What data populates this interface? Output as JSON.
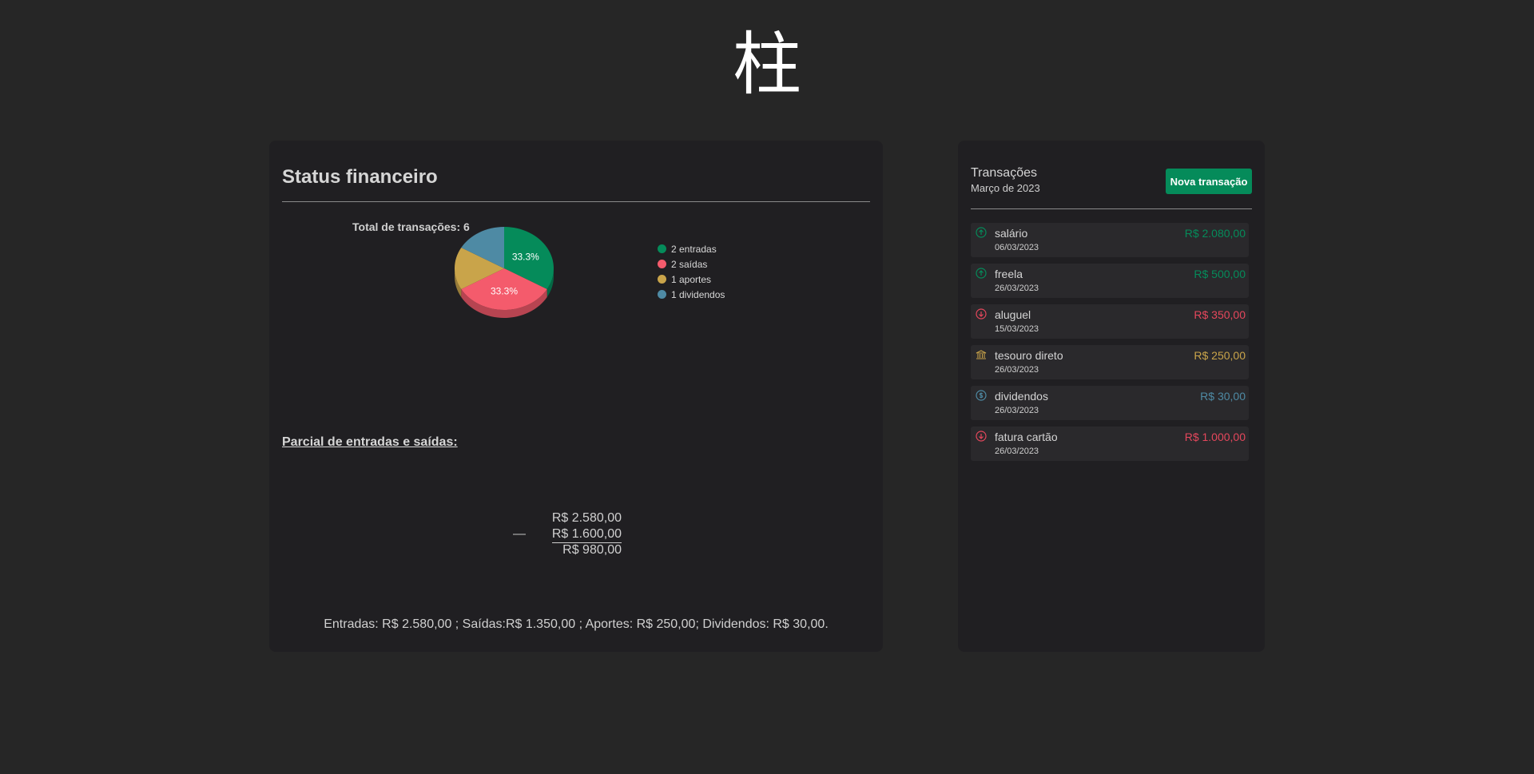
{
  "logo_text": "柱",
  "status": {
    "title": "Status financeiro",
    "partial_title": "Parcial de entradas e saídas:",
    "calc": {
      "income": "R$ 2.580,00",
      "minus_sign": "—",
      "expense": "R$ 1.600,00",
      "result": "R$ 980,00"
    },
    "summary": "Entradas: R$ 2.580,00 ;  Saídas:R$ 1.350,00 ;  Aportes: R$ 250,00;  Dividendos: R$ 30,00."
  },
  "chart_data": {
    "type": "pie",
    "title": "Total de transações: 6",
    "categories": [
      "2 entradas",
      "2 saídas",
      "1 aportes",
      "1 dividendos"
    ],
    "values": [
      2,
      2,
      1,
      1
    ],
    "data_labels": [
      "33.3%",
      "33.3%",
      "",
      ""
    ],
    "colors": [
      "#058b5a",
      "#f45b6c",
      "#c9a44a",
      "#4e8aa4"
    ],
    "legend_position": "right"
  },
  "transactions": {
    "title": "Transações",
    "month": "Março de 2023",
    "new_button": "Nova transação",
    "items": [
      {
        "name": "salário",
        "date": "06/03/2023",
        "amount": "R$ 2.080,00",
        "icon": "arrow-up-circle-icon",
        "color": "#058b5a"
      },
      {
        "name": "freela",
        "date": "26/03/2023",
        "amount": "R$ 500,00",
        "icon": "arrow-up-circle-icon",
        "color": "#058b5a"
      },
      {
        "name": "aluguel",
        "date": "15/03/2023",
        "amount": "R$ 350,00",
        "icon": "arrow-down-circle-icon",
        "color": "#e5475c"
      },
      {
        "name": "tesouro direto",
        "date": "26/03/2023",
        "amount": "R$ 250,00",
        "icon": "bank-icon",
        "color": "#c9a44a"
      },
      {
        "name": "dividendos",
        "date": "26/03/2023",
        "amount": "R$ 30,00",
        "icon": "dollar-circle-icon",
        "color": "#4e8aa4"
      },
      {
        "name": "fatura cartão",
        "date": "26/03/2023",
        "amount": "R$ 1.000,00",
        "icon": "arrow-down-circle-icon",
        "color": "#e5475c"
      }
    ]
  }
}
